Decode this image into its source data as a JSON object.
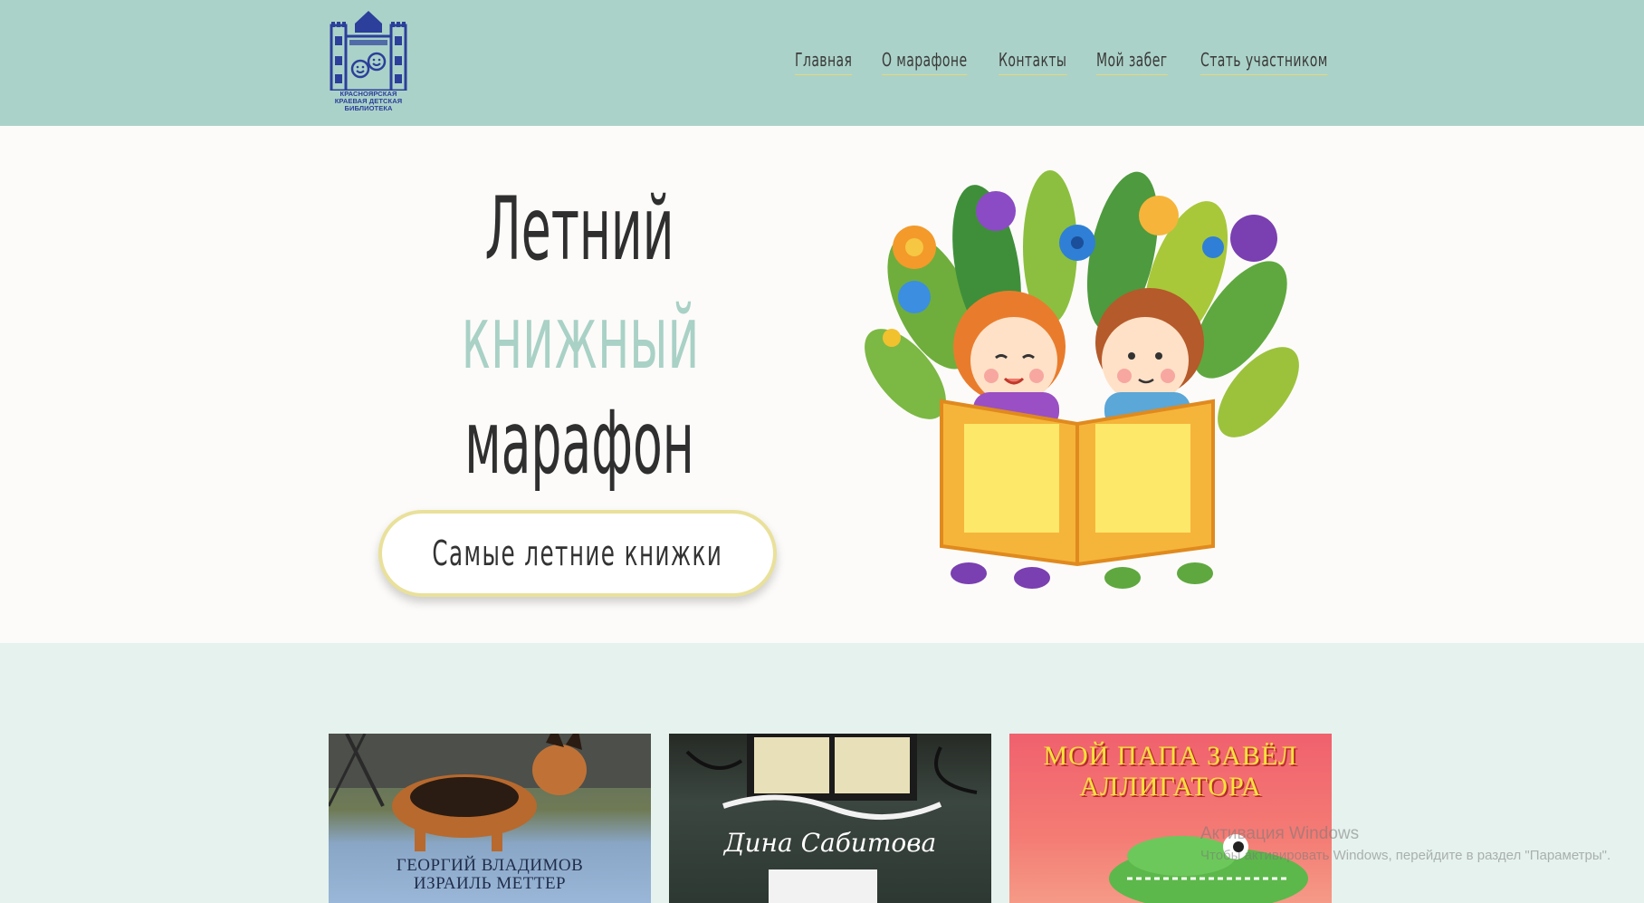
{
  "logo": {
    "line1": "КРАСНОЯРСКАЯ",
    "line2": "КРАЕВАЯ ДЕТСКАЯ",
    "line3": "БИБЛИОТЕКА"
  },
  "nav": {
    "items": [
      {
        "label": "Главная"
      },
      {
        "label": "О марафоне"
      },
      {
        "label": "Контакты"
      },
      {
        "label": "Мой забег"
      },
      {
        "label": "Стать участником"
      }
    ]
  },
  "hero": {
    "title_line1": "Летний",
    "title_line2": "книжный",
    "title_line3": "марафон",
    "cta_label": "Самые летние книжки",
    "colors": {
      "accent": "#a9d1c6",
      "header_bg": "#abd2c8",
      "button_border": "#e9e19a"
    }
  },
  "books": [
    {
      "author": "ГЕОРГИЙ ВЛАДИМОВ\nИЗРАИЛЬ МЕТТЕР"
    },
    {
      "author": "Дина Сабитова"
    },
    {
      "title": "МОЙ ПАПА ЗАВЁЛ\nАЛЛИГАТОРА"
    }
  ],
  "watermark": {
    "line1": "Активация Windows",
    "line2": "Чтобы активировать Windows, перейдите в раздел \"Параметры\"."
  }
}
